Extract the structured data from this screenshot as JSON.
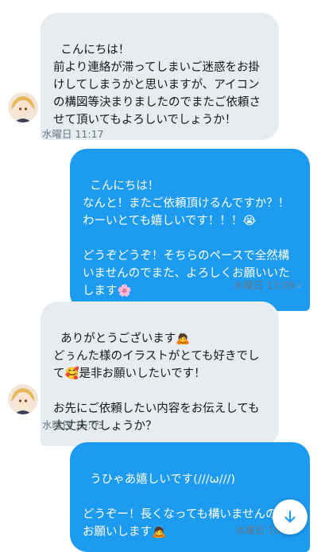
{
  "messages": [
    {
      "text": "こんにちは！\n前より連絡が滞ってしまいご迷惑をお掛けしてしまうかと思いますが、アイコンの構図等決まりましたのでまたご依頼させて頂いてもよろしいでしょうか！",
      "time": "水曜日 11:17"
    },
    {
      "text": "こんにちは！\nなんと！またご依頼頂けるんですか？！\nわーいとても嬉しいです！！！😭\n\nどうぞどうぞ！そちらのペースで全然構いませんのでまた、よろしくお願いいたします🌸",
      "time": "水曜日 13:09"
    },
    {
      "text": "ありがとうございます🙇\nどぅんた様のイラストがとても好きでして🥰是非お願いしたいです！\n\nお先にご依頼したい内容をお伝えしても大丈夫でしょうか？",
      "time": "水曜日 15:03"
    },
    {
      "text": "うひゃあ嬉しいです(///ω///)\n\nどうぞー！長くなっても構いませんのでお願いします🙇",
      "time": "水曜日 15:"
    }
  ],
  "colors": {
    "incoming_bubble": "#e7ecf0",
    "outgoing_bubble": "#1d9bf0",
    "meta_text": "#657786"
  },
  "icons": {
    "read_check": "✓",
    "scroll_down": "arrow-down-icon"
  }
}
